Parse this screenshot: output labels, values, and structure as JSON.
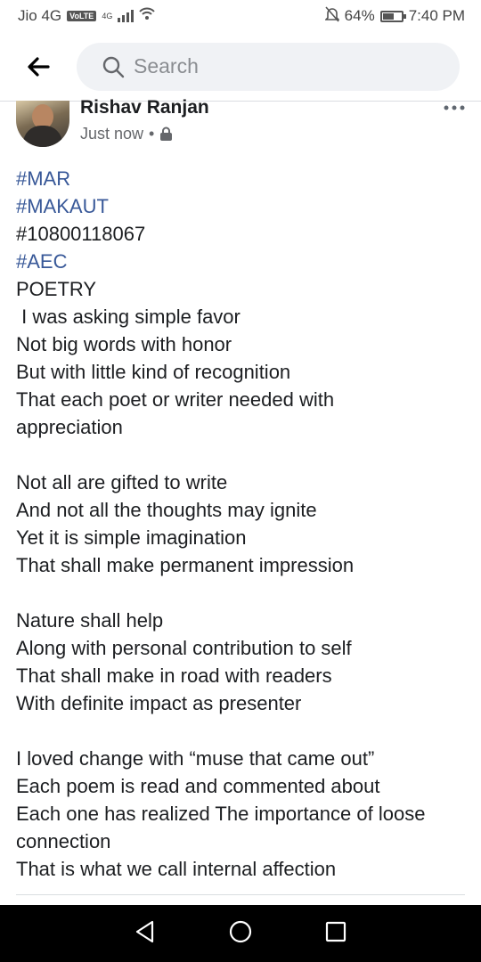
{
  "status_bar": {
    "carrier": "Jio 4G",
    "volte": "VoLTE",
    "network": "4G",
    "battery_percent_text": "64%",
    "battery_level": 0.64,
    "time": "7:40 PM"
  },
  "header": {
    "search_placeholder": "Search"
  },
  "post": {
    "author": "Rishav Ranjan",
    "timestamp": "Just now",
    "separator": "•",
    "lines": [
      {
        "text": "#MAR",
        "tag": true
      },
      {
        "text": "#MAKAUT",
        "tag": true
      },
      {
        "text": "#10800118067",
        "tag": false
      },
      {
        "text": "#AEC",
        "tag": true
      },
      {
        "text": "POETRY",
        "tag": false
      },
      {
        "text": " I was asking simple favor",
        "tag": false
      },
      {
        "text": "Not big words with honor",
        "tag": false
      },
      {
        "text": "But with little kind of recognition",
        "tag": false
      },
      {
        "text": "That each poet or writer needed with",
        "tag": false
      },
      {
        "text": "appreciation",
        "tag": false
      },
      {
        "text": "",
        "tag": false
      },
      {
        "text": "Not all are gifted to write",
        "tag": false
      },
      {
        "text": "And not all the thoughts may ignite",
        "tag": false
      },
      {
        "text": "Yet it is simple imagination",
        "tag": false
      },
      {
        "text": "That shall make permanent impression",
        "tag": false
      },
      {
        "text": "",
        "tag": false
      },
      {
        "text": "Nature shall help",
        "tag": false
      },
      {
        "text": "Along with personal contribution to self",
        "tag": false
      },
      {
        "text": "That shall make in road with readers",
        "tag": false
      },
      {
        "text": "With definite impact as presenter",
        "tag": false
      },
      {
        "text": "",
        "tag": false
      },
      {
        "text": "I loved change with “muse that came out”",
        "tag": false
      },
      {
        "text": "Each poem is read and commented about",
        "tag": false
      },
      {
        "text": "Each one has realized The importance of loose",
        "tag": false
      },
      {
        "text": "connection",
        "tag": false
      },
      {
        "text": "That is what we call internal affection",
        "tag": false
      }
    ]
  },
  "icons": {
    "back": "arrow-left-icon",
    "search": "search-icon",
    "privacy": "lock-icon",
    "more": "more-horizontal-icon",
    "nav_back": "triangle-back-icon",
    "nav_home": "circle-home-icon",
    "nav_recents": "square-recents-icon"
  }
}
